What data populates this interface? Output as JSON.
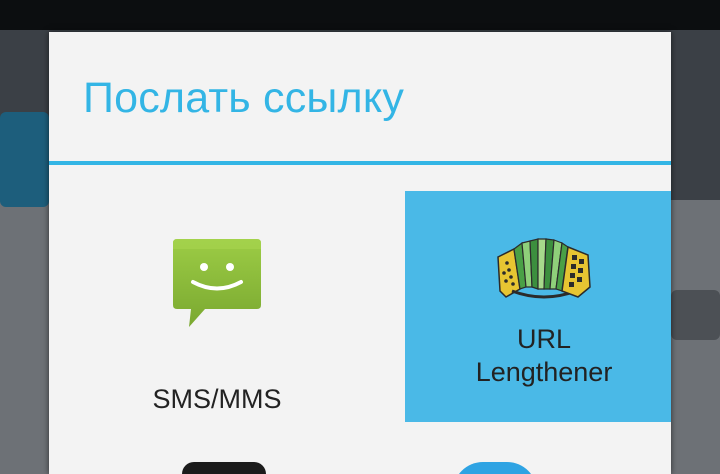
{
  "dialog": {
    "title": "Послать ссылку"
  },
  "apps": [
    {
      "label_lines": [
        "SMS/MMS"
      ],
      "icon": "sms-smiley-icon",
      "icon_color": "#8cb83c",
      "selected": false
    },
    {
      "label_lines": [
        "URL",
        "Lengthener"
      ],
      "icon": "accordion-icon",
      "selected": true,
      "selected_color": "#4ab9e7"
    }
  ],
  "colors": {
    "accent": "#33b5e5",
    "dialog_bg": "#f3f3f3",
    "text": "#222222"
  }
}
